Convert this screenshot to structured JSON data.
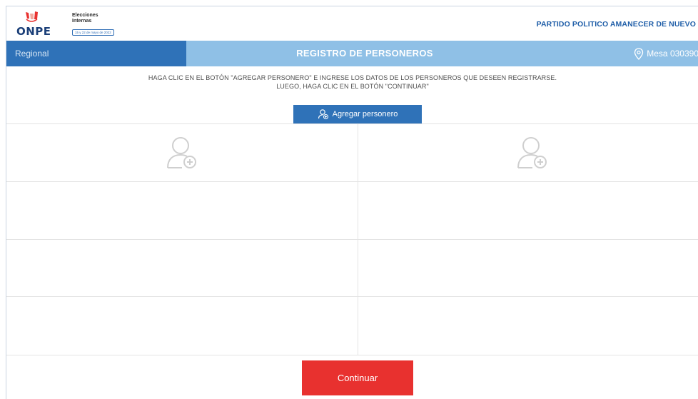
{
  "header": {
    "logo_text": "ONPE",
    "election_title_line1": "Elecciones",
    "election_title_line2": "Internas",
    "election_date": "15 y 22 de mayo de 2022",
    "party_name": "PARTIDO POLITICO AMANECER DE NUEVO"
  },
  "nav": {
    "region_label": "Regional",
    "page_title": "REGISTRO DE PERSONEROS",
    "mesa_label": "Mesa 030390"
  },
  "instructions": {
    "line1": "HAGA CLIC EN EL BOTÓN \"AGREGAR PERSONERO\" E INGRESE LOS DATOS DE LOS PERSONEROS QUE DESEEN REGISTRARSE.",
    "line2": "LUEGO, HAGA CLIC EN EL BOTÓN \"CONTINUAR\""
  },
  "buttons": {
    "add_label": "Agregar personero",
    "continue_label": "Continuar"
  },
  "slots": [
    {
      "icon": "add-user-icon"
    },
    {
      "icon": "add-user-icon"
    }
  ],
  "colors": {
    "primary_blue": "#2f72b8",
    "light_blue": "#8fc0e6",
    "continue_red": "#e8312f",
    "party_text": "#1f5ea8"
  }
}
